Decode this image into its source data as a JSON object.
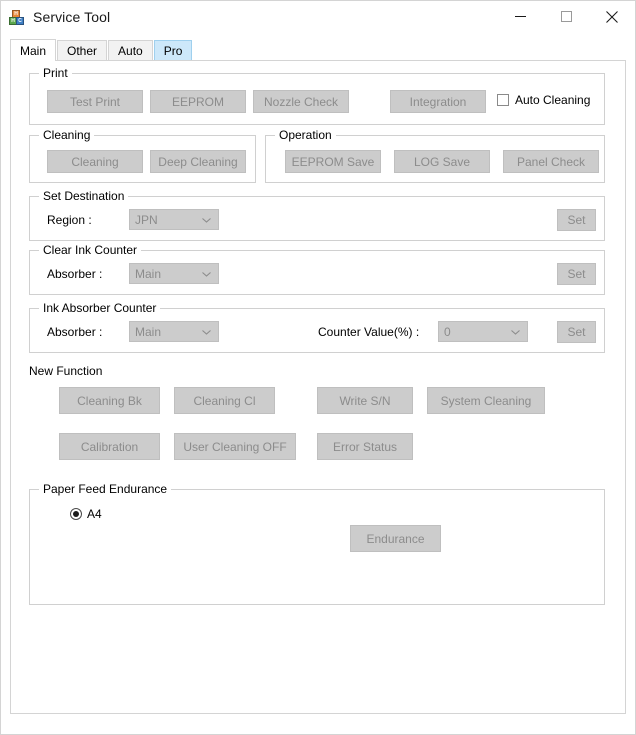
{
  "window": {
    "title": "Service Tool",
    "icon": "toy-blocks-icon",
    "controls": {
      "minimize": "minimize-icon",
      "maximize": "maximize-icon",
      "close": "close-icon"
    }
  },
  "tabs": [
    {
      "label": "Main",
      "state": "selected"
    },
    {
      "label": "Other",
      "state": "normal"
    },
    {
      "label": "Auto",
      "state": "normal"
    },
    {
      "label": "Pro",
      "state": "hovered"
    }
  ],
  "main": {
    "print": {
      "title": "Print",
      "buttons": [
        {
          "label": "Test Print",
          "disabled": true
        },
        {
          "label": "EEPROM",
          "disabled": true
        },
        {
          "label": "Nozzle Check",
          "disabled": true
        },
        {
          "label": "Integration",
          "disabled": true
        }
      ],
      "auto_cleaning": {
        "label": "Auto Cleaning",
        "checked": false
      }
    },
    "cleaning": {
      "title": "Cleaning",
      "buttons": [
        {
          "label": "Cleaning",
          "disabled": true
        },
        {
          "label": "Deep Cleaning",
          "disabled": true
        }
      ]
    },
    "operation": {
      "title": "Operation",
      "buttons": [
        {
          "label": "EEPROM Save",
          "disabled": true
        },
        {
          "label": "LOG Save",
          "disabled": true
        },
        {
          "label": "Panel Check",
          "disabled": true
        }
      ]
    },
    "set_destination": {
      "title": "Set Destination",
      "region_label": "Region :",
      "region_value": "JPN",
      "set_label": "Set"
    },
    "clear_ink_counter": {
      "title": "Clear Ink Counter",
      "absorber_label": "Absorber :",
      "absorber_value": "Main",
      "set_label": "Set"
    },
    "ink_absorber_counter": {
      "title": "Ink Absorber Counter",
      "absorber_label": "Absorber :",
      "absorber_value": "Main",
      "counter_label": "Counter Value(%) :",
      "counter_value": "0",
      "set_label": "Set"
    },
    "new_function": {
      "title": "New Function",
      "buttons_row1": [
        {
          "label": "Cleaning Bk",
          "disabled": true
        },
        {
          "label": "Cleaning Cl",
          "disabled": true
        },
        {
          "label": "Write S/N",
          "disabled": true
        },
        {
          "label": "System Cleaning",
          "disabled": true
        }
      ],
      "buttons_row2": [
        {
          "label": "Calibration",
          "disabled": true
        },
        {
          "label": "User Cleaning OFF",
          "disabled": true
        },
        {
          "label": "Error Status",
          "disabled": true
        }
      ]
    },
    "paper_feed_endurance": {
      "title": "Paper Feed Endurance",
      "radio_label": "A4",
      "radio_checked": true,
      "endurance_label": "Endurance"
    }
  },
  "colors": {
    "window_bg": "#ffffff",
    "desktop_bg": "#f0f0f0",
    "button_face_disabled": "#cccccc",
    "button_text_disabled": "#8c8c8c",
    "tab_hover": "#cde8fa",
    "group_border": "#d0d0d0"
  }
}
